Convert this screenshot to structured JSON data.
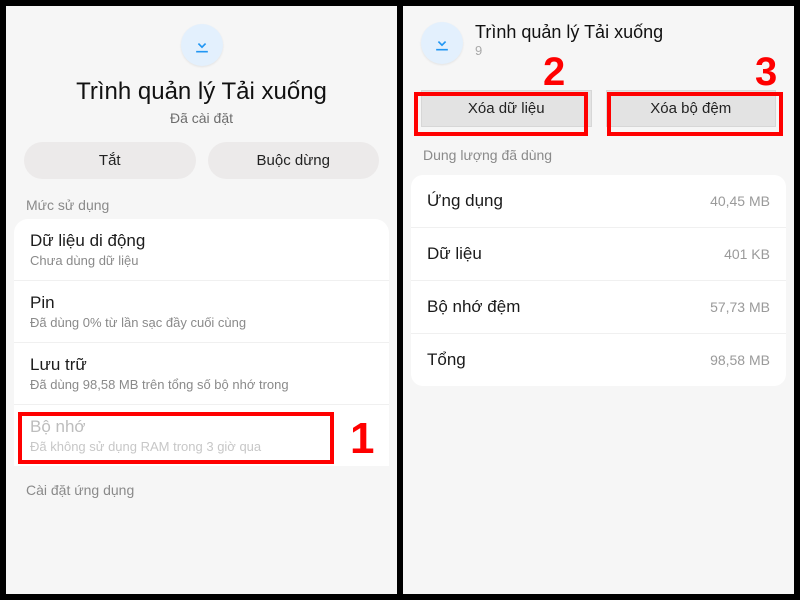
{
  "left": {
    "app_title": "Trình quản lý Tải xuống",
    "installed_label": "Đã cài đặt",
    "btn_disable": "Tắt",
    "btn_force_stop": "Buộc dừng",
    "usage_section": "Mức sử dụng",
    "rows": [
      {
        "label": "Dữ liệu di động",
        "sub": "Chưa dùng dữ liệu"
      },
      {
        "label": "Pin",
        "sub": "Đã dùng 0% từ lần sạc đầy cuối cùng"
      },
      {
        "label": "Lưu trữ",
        "sub": "Đã dùng 98,58 MB trên tổng số bộ nhớ trong"
      },
      {
        "label": "Bộ nhớ",
        "sub": "Đã không sử dụng RAM trong 3 giờ qua"
      }
    ],
    "app_settings_section": "Cài đặt ứng dụng"
  },
  "right": {
    "app_title": "Trình quản lý Tải xuống",
    "version_prefix": "9",
    "btn_clear_data": "Xóa dữ liệu",
    "btn_clear_cache": "Xóa bộ đệm",
    "usage_section": "Dung lượng đã dùng",
    "rows": [
      {
        "k": "Ứng dụng",
        "v": "40,45 MB"
      },
      {
        "k": "Dữ liệu",
        "v": "401 KB"
      },
      {
        "k": "Bộ nhớ đệm",
        "v": "57,73 MB"
      },
      {
        "k": "Tổng",
        "v": "98,58 MB"
      }
    ]
  },
  "annotations": {
    "n1": "1",
    "n2": "2",
    "n3": "3"
  }
}
